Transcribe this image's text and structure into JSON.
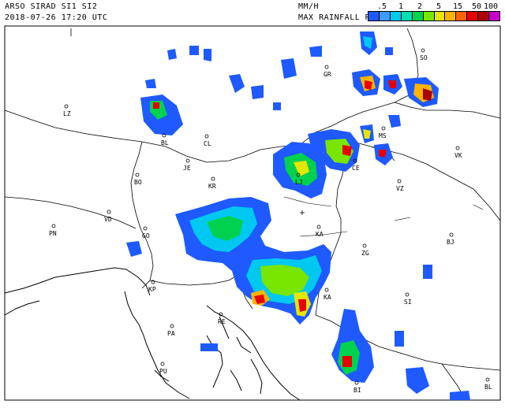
{
  "header": {
    "title": "ARSO SIRAD SI1 SI2",
    "timestamp": "2018-07-26 17:20 UTC",
    "units": "MM/H",
    "product": "MAX RAINFALL RATE"
  },
  "legend": {
    "ticks": [
      ".5",
      "1",
      "2",
      "5",
      "15",
      "50",
      "100"
    ],
    "colors": [
      "#1e5aff",
      "#3c9bff",
      "#00c8f0",
      "#00dcb4",
      "#00d250",
      "#78e600",
      "#e6e600",
      "#ffb400",
      "#ff6400",
      "#e60000",
      "#aa0000",
      "#c800c8"
    ]
  },
  "cities": [
    {
      "code": "LZ"
    },
    {
      "code": "GR"
    },
    {
      "code": "SO"
    },
    {
      "code": "BL"
    },
    {
      "code": "CL"
    },
    {
      "code": "JE"
    },
    {
      "code": "MS"
    },
    {
      "code": "VK"
    },
    {
      "code": "BO"
    },
    {
      "code": "KR"
    },
    {
      "code": "LJ"
    },
    {
      "code": "CE"
    },
    {
      "code": "VZ"
    },
    {
      "code": "VD"
    },
    {
      "code": "PN"
    },
    {
      "code": "GO"
    },
    {
      "code": "KA"
    },
    {
      "code": "BJ"
    },
    {
      "code": "ZG"
    },
    {
      "code": "KP"
    },
    {
      "code": "SI"
    },
    {
      "code": "KA"
    },
    {
      "code": "RE"
    },
    {
      "code": "PA"
    },
    {
      "code": "PU"
    },
    {
      "code": "BI"
    },
    {
      "code": "BL"
    }
  ]
}
